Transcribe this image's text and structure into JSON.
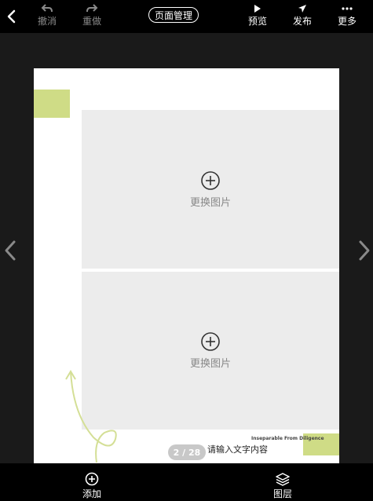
{
  "toolbar": {
    "undo_label": "撤消",
    "redo_label": "重做",
    "page_manage_label": "页面管理",
    "preview_label": "预览",
    "publish_label": "发布",
    "more_label": "更多"
  },
  "canvas": {
    "placeholder_1": {
      "label": "更换图片"
    },
    "placeholder_2": {
      "label": "更换图片"
    },
    "tagline": "Inseparable From Diligence",
    "text_placeholder": "请输入文字内容",
    "page_indicator": "2 / 28"
  },
  "bottom": {
    "add_label": "添加",
    "layers_label": "图层"
  },
  "colors": {
    "accent_green": "#cfdc86",
    "placeholder_bg": "#ececec",
    "bar_bg": "#000000"
  },
  "icons": [
    "back-icon",
    "undo-icon",
    "redo-icon",
    "play-icon",
    "send-icon",
    "more-icon",
    "chevron-left-icon",
    "chevron-right-icon",
    "add-circle-icon",
    "layers-icon"
  ]
}
